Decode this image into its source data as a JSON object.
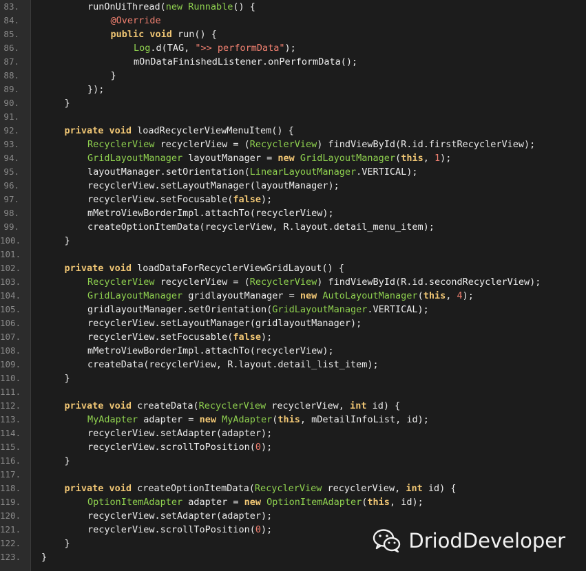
{
  "editor": {
    "language": "java",
    "colors": {
      "background": "#1c1c1c",
      "gutter": "#2c2c2c",
      "line_number": "#8a8a8a",
      "text": "#ececec",
      "keyword": "#f0c674",
      "type": "#8fd14f",
      "string": "#f08070",
      "annotation": "#f08070",
      "number": "#f08070"
    },
    "lines": [
      {
        "num": "83.",
        "indent": 2,
        "tokens": [
          {
            "t": "text",
            "v": "runOnUiThread("
          },
          {
            "t": "type",
            "v": "new Runnable"
          },
          {
            "t": "text",
            "v": "() {"
          }
        ]
      },
      {
        "num": "84.",
        "indent": 3,
        "tokens": [
          {
            "t": "anno",
            "v": "@Override"
          }
        ]
      },
      {
        "num": "85.",
        "indent": 3,
        "tokens": [
          {
            "t": "kw",
            "v": "public void"
          },
          {
            "t": "text",
            "v": " run() {"
          }
        ]
      },
      {
        "num": "86.",
        "indent": 4,
        "tokens": [
          {
            "t": "type",
            "v": "Log"
          },
          {
            "t": "text",
            "v": ".d(TAG, "
          },
          {
            "t": "str",
            "v": "\">> performData\""
          },
          {
            "t": "text",
            "v": ");"
          }
        ]
      },
      {
        "num": "87.",
        "indent": 4,
        "tokens": [
          {
            "t": "text",
            "v": "mOnDataFinishedListener.onPerformData();"
          }
        ]
      },
      {
        "num": "88.",
        "indent": 3,
        "tokens": [
          {
            "t": "text",
            "v": "}"
          }
        ]
      },
      {
        "num": "89.",
        "indent": 2,
        "tokens": [
          {
            "t": "text",
            "v": "});"
          }
        ]
      },
      {
        "num": "90.",
        "indent": 1,
        "tokens": [
          {
            "t": "text",
            "v": "}"
          }
        ]
      },
      {
        "num": "91.",
        "indent": 0,
        "tokens": []
      },
      {
        "num": "92.",
        "indent": 1,
        "tokens": [
          {
            "t": "kw",
            "v": "private void"
          },
          {
            "t": "text",
            "v": " loadRecyclerViewMenuItem() {"
          }
        ]
      },
      {
        "num": "93.",
        "indent": 2,
        "tokens": [
          {
            "t": "type",
            "v": "RecyclerView"
          },
          {
            "t": "text",
            "v": " recyclerView = ("
          },
          {
            "t": "type",
            "v": "RecyclerView"
          },
          {
            "t": "text",
            "v": ") findViewById(R.id.firstRecyclerView);"
          }
        ]
      },
      {
        "num": "94.",
        "indent": 2,
        "tokens": [
          {
            "t": "type",
            "v": "GridLayoutManager"
          },
          {
            "t": "text",
            "v": " layoutManager = "
          },
          {
            "t": "kw",
            "v": "new"
          },
          {
            "t": "text",
            "v": " "
          },
          {
            "t": "type",
            "v": "GridLayoutManager"
          },
          {
            "t": "text",
            "v": "("
          },
          {
            "t": "kw",
            "v": "this"
          },
          {
            "t": "text",
            "v": ", "
          },
          {
            "t": "num",
            "v": "1"
          },
          {
            "t": "text",
            "v": ");"
          }
        ]
      },
      {
        "num": "95.",
        "indent": 2,
        "tokens": [
          {
            "t": "text",
            "v": "layoutManager.setOrientation("
          },
          {
            "t": "type",
            "v": "LinearLayoutManager"
          },
          {
            "t": "text",
            "v": ".VERTICAL);"
          }
        ]
      },
      {
        "num": "96.",
        "indent": 2,
        "tokens": [
          {
            "t": "text",
            "v": "recyclerView.setLayoutManager(layoutManager);"
          }
        ]
      },
      {
        "num": "97.",
        "indent": 2,
        "tokens": [
          {
            "t": "text",
            "v": "recyclerView.setFocusable("
          },
          {
            "t": "kw",
            "v": "false"
          },
          {
            "t": "text",
            "v": ");"
          }
        ]
      },
      {
        "num": "98.",
        "indent": 2,
        "tokens": [
          {
            "t": "text",
            "v": "mMetroViewBorderImpl.attachTo(recyclerView);"
          }
        ]
      },
      {
        "num": "99.",
        "indent": 2,
        "tokens": [
          {
            "t": "text",
            "v": "createOptionItemData(recyclerView, R.layout.detail_menu_item);"
          }
        ]
      },
      {
        "num": "100.",
        "indent": 1,
        "tokens": [
          {
            "t": "text",
            "v": "}"
          }
        ]
      },
      {
        "num": "101.",
        "indent": 0,
        "tokens": []
      },
      {
        "num": "102.",
        "indent": 1,
        "tokens": [
          {
            "t": "kw",
            "v": "private void"
          },
          {
            "t": "text",
            "v": " loadDataForRecyclerViewGridLayout() {"
          }
        ]
      },
      {
        "num": "103.",
        "indent": 2,
        "tokens": [
          {
            "t": "type",
            "v": "RecyclerView"
          },
          {
            "t": "text",
            "v": " recyclerView = ("
          },
          {
            "t": "type",
            "v": "RecyclerView"
          },
          {
            "t": "text",
            "v": ") findViewById(R.id.secondRecyclerView);"
          }
        ]
      },
      {
        "num": "104.",
        "indent": 2,
        "tokens": [
          {
            "t": "type",
            "v": "GridLayoutManager"
          },
          {
            "t": "text",
            "v": " gridlayoutManager = "
          },
          {
            "t": "kw",
            "v": "new"
          },
          {
            "t": "text",
            "v": " "
          },
          {
            "t": "type",
            "v": "AutoLayoutManager"
          },
          {
            "t": "text",
            "v": "("
          },
          {
            "t": "kw",
            "v": "this"
          },
          {
            "t": "text",
            "v": ", "
          },
          {
            "t": "num",
            "v": "4"
          },
          {
            "t": "text",
            "v": ");"
          }
        ]
      },
      {
        "num": "105.",
        "indent": 2,
        "tokens": [
          {
            "t": "text",
            "v": "gridlayoutManager.setOrientation("
          },
          {
            "t": "type",
            "v": "GridLayoutManager"
          },
          {
            "t": "text",
            "v": ".VERTICAL);"
          }
        ]
      },
      {
        "num": "106.",
        "indent": 2,
        "tokens": [
          {
            "t": "text",
            "v": "recyclerView.setLayoutManager(gridlayoutManager);"
          }
        ]
      },
      {
        "num": "107.",
        "indent": 2,
        "tokens": [
          {
            "t": "text",
            "v": "recyclerView.setFocusable("
          },
          {
            "t": "kw",
            "v": "false"
          },
          {
            "t": "text",
            "v": ");"
          }
        ]
      },
      {
        "num": "108.",
        "indent": 2,
        "tokens": [
          {
            "t": "text",
            "v": "mMetroViewBorderImpl.attachTo(recyclerView);"
          }
        ]
      },
      {
        "num": "109.",
        "indent": 2,
        "tokens": [
          {
            "t": "text",
            "v": "createData(recyclerView, R.layout.detail_list_item);"
          }
        ]
      },
      {
        "num": "110.",
        "indent": 1,
        "tokens": [
          {
            "t": "text",
            "v": "}"
          }
        ]
      },
      {
        "num": "111.",
        "indent": 0,
        "tokens": []
      },
      {
        "num": "112.",
        "indent": 1,
        "tokens": [
          {
            "t": "kw",
            "v": "private void"
          },
          {
            "t": "text",
            "v": " createData("
          },
          {
            "t": "type",
            "v": "RecyclerView"
          },
          {
            "t": "text",
            "v": " recyclerView, "
          },
          {
            "t": "kw",
            "v": "int"
          },
          {
            "t": "text",
            "v": " id) {"
          }
        ]
      },
      {
        "num": "113.",
        "indent": 2,
        "tokens": [
          {
            "t": "type",
            "v": "MyAdapter"
          },
          {
            "t": "text",
            "v": " adapter = "
          },
          {
            "t": "kw",
            "v": "new"
          },
          {
            "t": "text",
            "v": " "
          },
          {
            "t": "type",
            "v": "MyAdapter"
          },
          {
            "t": "text",
            "v": "("
          },
          {
            "t": "kw",
            "v": "this"
          },
          {
            "t": "text",
            "v": ", mDetailInfoList, id);"
          }
        ]
      },
      {
        "num": "114.",
        "indent": 2,
        "tokens": [
          {
            "t": "text",
            "v": "recyclerView.setAdapter(adapter);"
          }
        ]
      },
      {
        "num": "115.",
        "indent": 2,
        "tokens": [
          {
            "t": "text",
            "v": "recyclerView.scrollToPosition("
          },
          {
            "t": "num",
            "v": "0"
          },
          {
            "t": "text",
            "v": ");"
          }
        ]
      },
      {
        "num": "116.",
        "indent": 1,
        "tokens": [
          {
            "t": "text",
            "v": "}"
          }
        ]
      },
      {
        "num": "117.",
        "indent": 0,
        "tokens": []
      },
      {
        "num": "118.",
        "indent": 1,
        "tokens": [
          {
            "t": "kw",
            "v": "private void"
          },
          {
            "t": "text",
            "v": " createOptionItemData("
          },
          {
            "t": "type",
            "v": "RecyclerView"
          },
          {
            "t": "text",
            "v": " recyclerView, "
          },
          {
            "t": "kw",
            "v": "int"
          },
          {
            "t": "text",
            "v": " id) {"
          }
        ]
      },
      {
        "num": "119.",
        "indent": 2,
        "tokens": [
          {
            "t": "type",
            "v": "OptionItemAdapter"
          },
          {
            "t": "text",
            "v": " adapter = "
          },
          {
            "t": "kw",
            "v": "new"
          },
          {
            "t": "text",
            "v": " "
          },
          {
            "t": "type",
            "v": "OptionItemAdapter"
          },
          {
            "t": "text",
            "v": "("
          },
          {
            "t": "kw",
            "v": "this"
          },
          {
            "t": "text",
            "v": ", id);"
          }
        ]
      },
      {
        "num": "120.",
        "indent": 2,
        "tokens": [
          {
            "t": "text",
            "v": "recyclerView.setAdapter(adapter);"
          }
        ]
      },
      {
        "num": "121.",
        "indent": 2,
        "tokens": [
          {
            "t": "text",
            "v": "recyclerView.scrollToPosition("
          },
          {
            "t": "num",
            "v": "0"
          },
          {
            "t": "text",
            "v": ");"
          }
        ]
      },
      {
        "num": "122.",
        "indent": 1,
        "tokens": [
          {
            "t": "text",
            "v": "}"
          }
        ]
      },
      {
        "num": "123.",
        "indent": 0,
        "tokens": [
          {
            "t": "text",
            "v": "}"
          }
        ]
      }
    ]
  },
  "watermark": {
    "icon": "wechat-icon",
    "text": "DriodDeveloper"
  }
}
